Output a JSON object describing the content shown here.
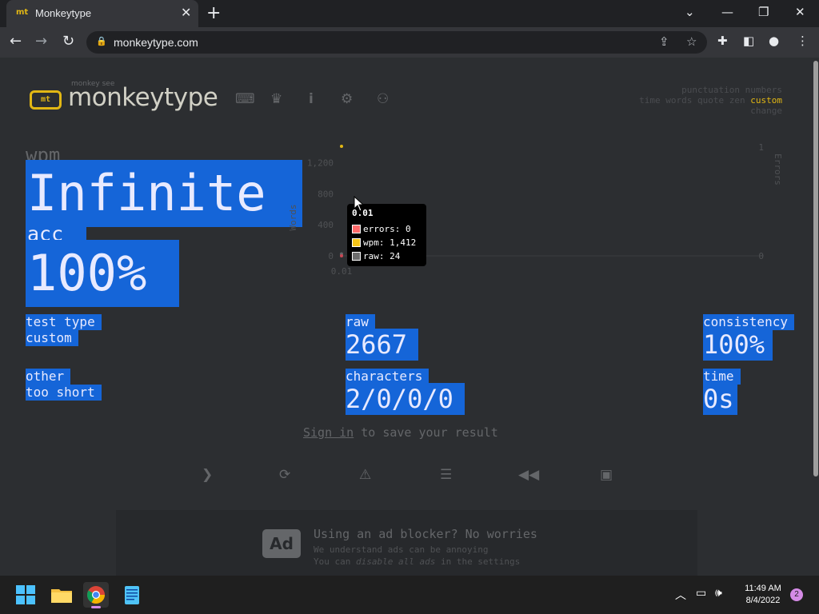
{
  "browser": {
    "tab_title": "Monkeytype",
    "tab_favicon": "mt",
    "url": "monkeytype.com"
  },
  "header": {
    "logo_subtitle": "monkey see",
    "logo_text": "monkeytype",
    "logo_icon": "mt"
  },
  "config": {
    "line1": "punctuation numbers",
    "line2_modes": [
      "time",
      "words",
      "quote",
      "zen"
    ],
    "line2_active": "custom",
    "line3": "change"
  },
  "result": {
    "wpm_label": "wpm",
    "wpm_value": "Infinite",
    "acc_label": "acc",
    "acc_value": "100%"
  },
  "chart_data": {
    "type": "line",
    "x": [
      0.01
    ],
    "series": [
      {
        "name": "wpm",
        "values": [
          1412
        ],
        "color": "#e2b714"
      },
      {
        "name": "raw",
        "values": [
          24
        ],
        "color": "#646669"
      },
      {
        "name": "errors",
        "values": [
          0
        ],
        "color": "#ca4754"
      }
    ],
    "x_tick_labels": [
      "0.01"
    ],
    "y_left_label": "Words",
    "y_left_ticks": [
      "1,200",
      "800",
      "400",
      "0"
    ],
    "y_right_label": "Errors",
    "y_right_ticks": [
      "1",
      "0"
    ],
    "ylim": [
      0,
      1400
    ],
    "tooltip": {
      "title": "0.01",
      "rows": [
        {
          "label": "errors: 0",
          "color": "#ff6b6b"
        },
        {
          "label": "wpm: 1,412",
          "color": "#f5c518"
        },
        {
          "label": "raw: 24",
          "color": "#6d6d6d"
        }
      ]
    }
  },
  "stats": {
    "test_type_label": "test type",
    "test_type_value": "custom",
    "other_label": "other",
    "other_value": "too short",
    "raw_label": "raw",
    "raw_value": "2667",
    "characters_label": "characters",
    "characters_value": "2/0/0/0",
    "consistency_label": "consistency",
    "consistency_value": "100%",
    "time_label": "time",
    "time_value": "0s"
  },
  "signin": {
    "link": "Sign in",
    "text": " to save your result"
  },
  "actions": [
    "next-test",
    "restart",
    "report",
    "words-history",
    "replay",
    "screenshot"
  ],
  "ad": {
    "badge": "Ad",
    "heading": "Using an ad blocker? No worries",
    "line1": "We understand ads can be annoying",
    "line2_prefix": "You can ",
    "line2_em": "disable all ads",
    "line2_suffix": " in the settings"
  },
  "taskbar": {
    "time": "11:49 AM",
    "date": "8/4/2022",
    "notifications": "2"
  },
  "colors": {
    "accent": "#e2b714",
    "background": "#2c2e31",
    "selection": "#1565d8",
    "subtle": "#646669"
  }
}
